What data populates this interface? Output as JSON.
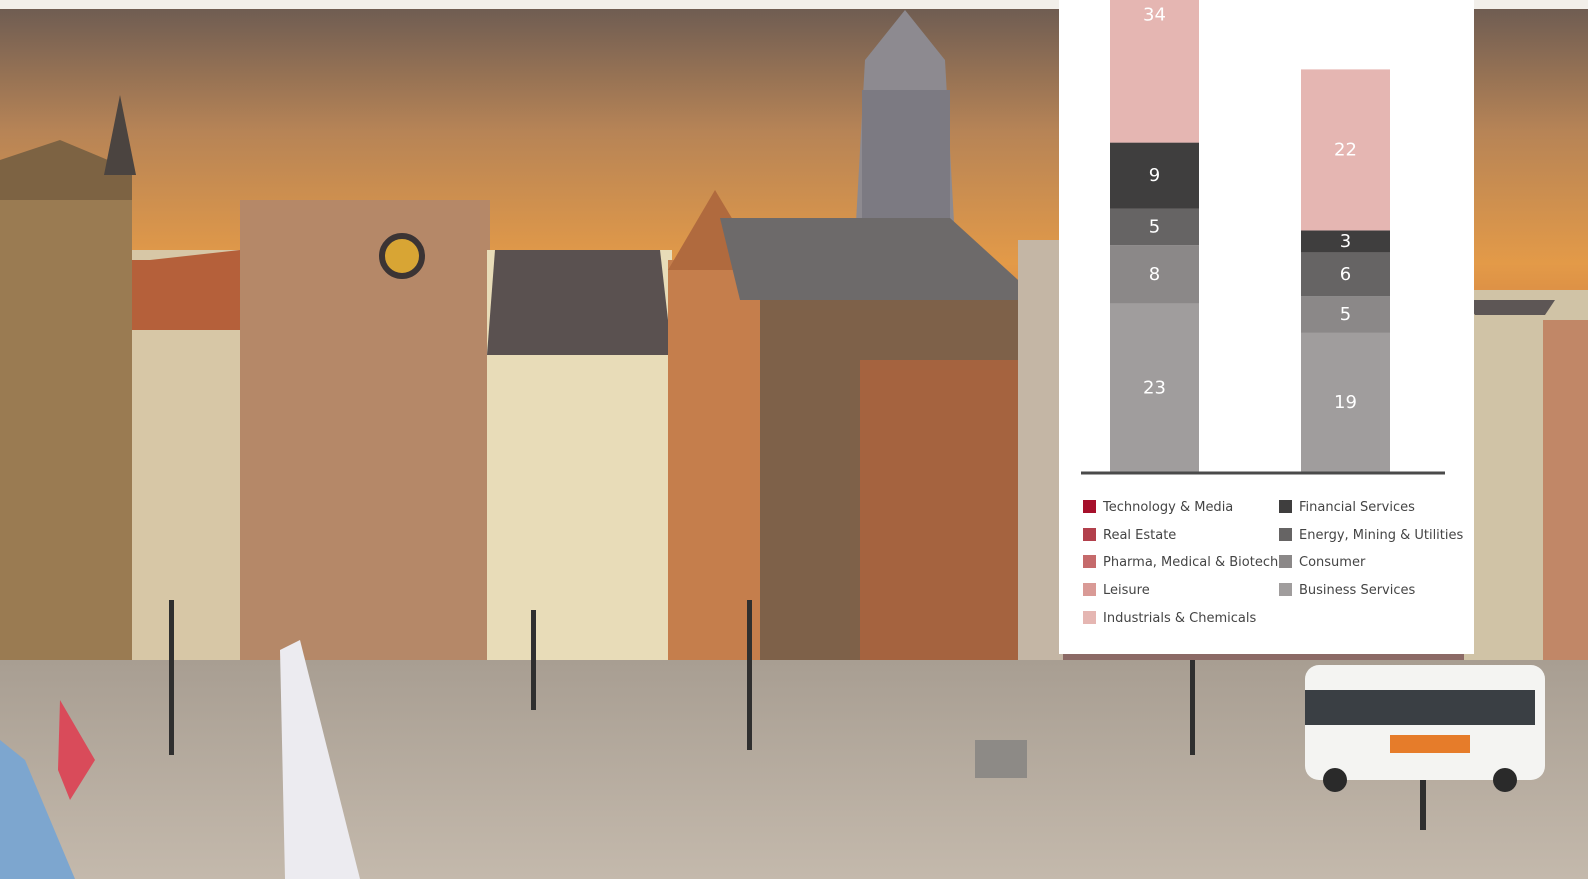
{
  "chart_data": {
    "type": "bar",
    "stacked": true,
    "categories": [
      "",
      ""
    ],
    "series": [
      {
        "name": "Business Services",
        "values": [
          23,
          19
        ],
        "color": "#a09d9d"
      },
      {
        "name": "Consumer",
        "values": [
          8,
          5
        ],
        "color": "#8b8888"
      },
      {
        "name": "Energy, Mining & Utilities",
        "values": [
          5,
          6
        ],
        "color": "#666464"
      },
      {
        "name": "Financial Services",
        "values": [
          9,
          3
        ],
        "color": "#3f3e3e"
      },
      {
        "name": "Industrials & Chemicals",
        "values": [
          34,
          22
        ],
        "color": "#e5b6b2"
      },
      {
        "name": "Leisure",
        "values": [
          null,
          null
        ],
        "color": "#d99a96"
      },
      {
        "name": "Pharma, Medical & Biotech",
        "values": [
          null,
          null
        ],
        "color": "#c56a6b"
      },
      {
        "name": "Real Estate",
        "values": [
          null,
          null
        ],
        "color": "#b2404c"
      },
      {
        "name": "Technology & Media",
        "values": [
          null,
          null
        ],
        "color": "#a6102b"
      }
    ],
    "legend": {
      "placement": "bottom",
      "left": [
        "Technology & Media",
        "Real Estate",
        "Pharma, Medical & Biotech",
        "Leisure",
        "Industrials & Chemicals"
      ],
      "right": [
        "Financial Services",
        "Energy, Mining & Utilities",
        "Consumer",
        "Business Services"
      ]
    },
    "title": "",
    "xlabel": "",
    "ylabel": "",
    "grid": false
  }
}
